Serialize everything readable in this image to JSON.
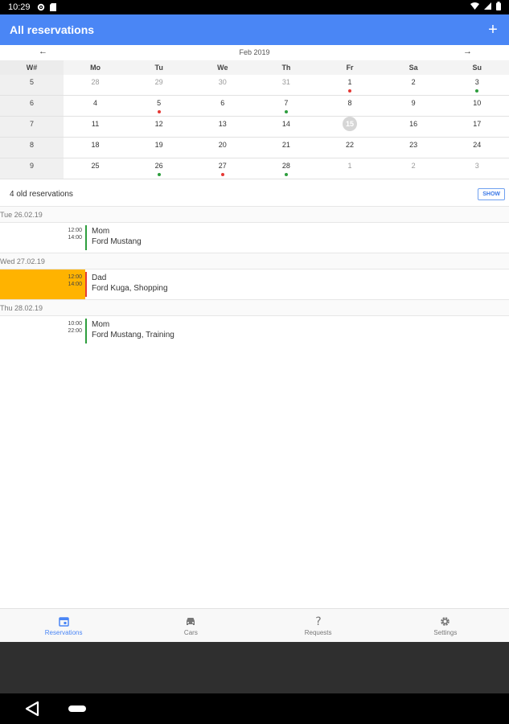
{
  "status_bar": {
    "time": "10:29",
    "icons": [
      "gear-icon",
      "sd-card-icon",
      "wifi-icon",
      "signal-icon",
      "battery-icon"
    ]
  },
  "app_bar": {
    "title": "All reservations",
    "add_label": "+"
  },
  "calendar": {
    "month_label": "Feb 2019",
    "prev_label": "←",
    "next_label": "→",
    "weekday_headers": [
      "W#",
      "Mo",
      "Tu",
      "We",
      "Th",
      "Fr",
      "Sa",
      "Su"
    ],
    "weeks": [
      {
        "week": "5",
        "days": [
          {
            "d": "28",
            "other": true
          },
          {
            "d": "29",
            "other": true
          },
          {
            "d": "30",
            "other": true
          },
          {
            "d": "31",
            "other": true
          },
          {
            "d": "1",
            "dot": "red"
          },
          {
            "d": "2"
          },
          {
            "d": "3",
            "dot": "green"
          }
        ]
      },
      {
        "week": "6",
        "days": [
          {
            "d": "4"
          },
          {
            "d": "5",
            "dot": "red"
          },
          {
            "d": "6"
          },
          {
            "d": "7",
            "dot": "green"
          },
          {
            "d": "8"
          },
          {
            "d": "9"
          },
          {
            "d": "10"
          }
        ]
      },
      {
        "week": "7",
        "days": [
          {
            "d": "11"
          },
          {
            "d": "12"
          },
          {
            "d": "13"
          },
          {
            "d": "14"
          },
          {
            "d": "15",
            "today": true
          },
          {
            "d": "16"
          },
          {
            "d": "17"
          }
        ]
      },
      {
        "week": "8",
        "days": [
          {
            "d": "18"
          },
          {
            "d": "19"
          },
          {
            "d": "20"
          },
          {
            "d": "21"
          },
          {
            "d": "22"
          },
          {
            "d": "23"
          },
          {
            "d": "24"
          }
        ]
      },
      {
        "week": "9",
        "days": [
          {
            "d": "25"
          },
          {
            "d": "26",
            "dot": "green"
          },
          {
            "d": "27",
            "dot": "red"
          },
          {
            "d": "28",
            "dot": "green"
          },
          {
            "d": "1",
            "other": true
          },
          {
            "d": "2",
            "other": true
          },
          {
            "d": "3",
            "other": true
          }
        ]
      }
    ]
  },
  "old_reservations": {
    "text": "4 old reservations",
    "button_label": "SHOW"
  },
  "reservations": [
    {
      "date": "Tue 26.02.19",
      "items": [
        {
          "start": "12:00",
          "end": "14:00",
          "person": "Mom",
          "details": "Ford Mustang",
          "color": "green",
          "highlight": false
        }
      ]
    },
    {
      "date": "Wed 27.02.19",
      "items": [
        {
          "start": "12:00",
          "end": "14:00",
          "person": "Dad",
          "details": "Ford Kuga, Shopping",
          "color": "red",
          "highlight": true
        }
      ]
    },
    {
      "date": "Thu 28.02.19",
      "items": [
        {
          "start": "10:00",
          "end": "22:00",
          "person": "Mom",
          "details": "Ford Mustang, Training",
          "color": "green",
          "highlight": false
        }
      ]
    }
  ],
  "bottom_nav": [
    {
      "label": "Reservations",
      "icon": "calendar-icon",
      "active": true
    },
    {
      "label": "Cars",
      "icon": "car-icon",
      "active": false
    },
    {
      "label": "Requests",
      "icon": "question-icon",
      "active": false
    },
    {
      "label": "Settings",
      "icon": "gear-icon",
      "active": false
    }
  ],
  "colors": {
    "accent": "#4a86f5",
    "highlight": "#ffb300",
    "dot_red": "#e53935",
    "dot_green": "#2e9e3e"
  }
}
